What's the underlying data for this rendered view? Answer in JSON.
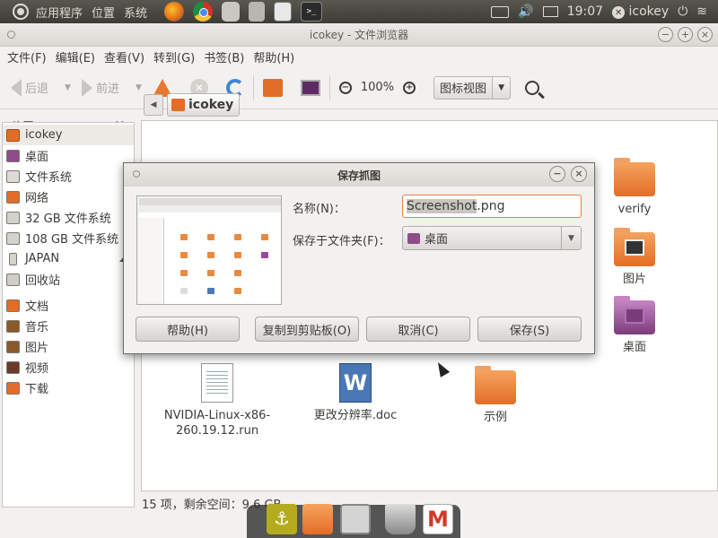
{
  "top_panel": {
    "menus": [
      "应用程序",
      "位置",
      "系统"
    ],
    "clock": "19:07",
    "user": "icokey",
    "launcher_icons": [
      "firefox-icon",
      "chrome-icon",
      "disk-utility-icon",
      "calculator-icon",
      "text-editor-icon",
      "terminal-icon"
    ]
  },
  "window": {
    "title": "icokey - 文件浏览器",
    "menubar": [
      "文件(F)",
      "编辑(E)",
      "查看(V)",
      "转到(G)",
      "书签(B)",
      "帮助(H)"
    ],
    "toolbar": {
      "back": "后退",
      "forward": "前进",
      "zoom": "100%",
      "view_mode": "图标视图"
    },
    "sidebar": {
      "header": "位置",
      "items": [
        "icokey",
        "桌面",
        "文件系统",
        "网络",
        "32 GB 文件系统",
        "108 GB 文件系统",
        "JAPAN",
        "回收站",
        "文档",
        "音乐",
        "图片",
        "视频",
        "下载"
      ]
    },
    "location": {
      "crumb": "icokey"
    },
    "files": {
      "verify": "verify",
      "pictures": "图片",
      "desktop": "桌面",
      "nvidia_line1": "NVIDIA-Linux-x86-",
      "nvidia_line2": "260.19.12.run",
      "doc": "更改分辨率.doc",
      "examples": "示例"
    },
    "status": "15 项，剩余空间：9.6 GB"
  },
  "dialog": {
    "title": "保存抓图",
    "name_label": "名称(N)：",
    "name_selected": "Screenshot",
    "name_ext": ".png",
    "folder_label": "保存于文件夹(F)：",
    "folder_value": "桌面",
    "buttons": {
      "help": "帮助(H)",
      "copy": "复制到剪贴板(O)",
      "cancel": "取消(C)",
      "save": "保存(S)"
    }
  },
  "colors": {
    "accent": "#e36d28",
    "panel": "#3c3b37",
    "purple": "#7a3c7a"
  }
}
